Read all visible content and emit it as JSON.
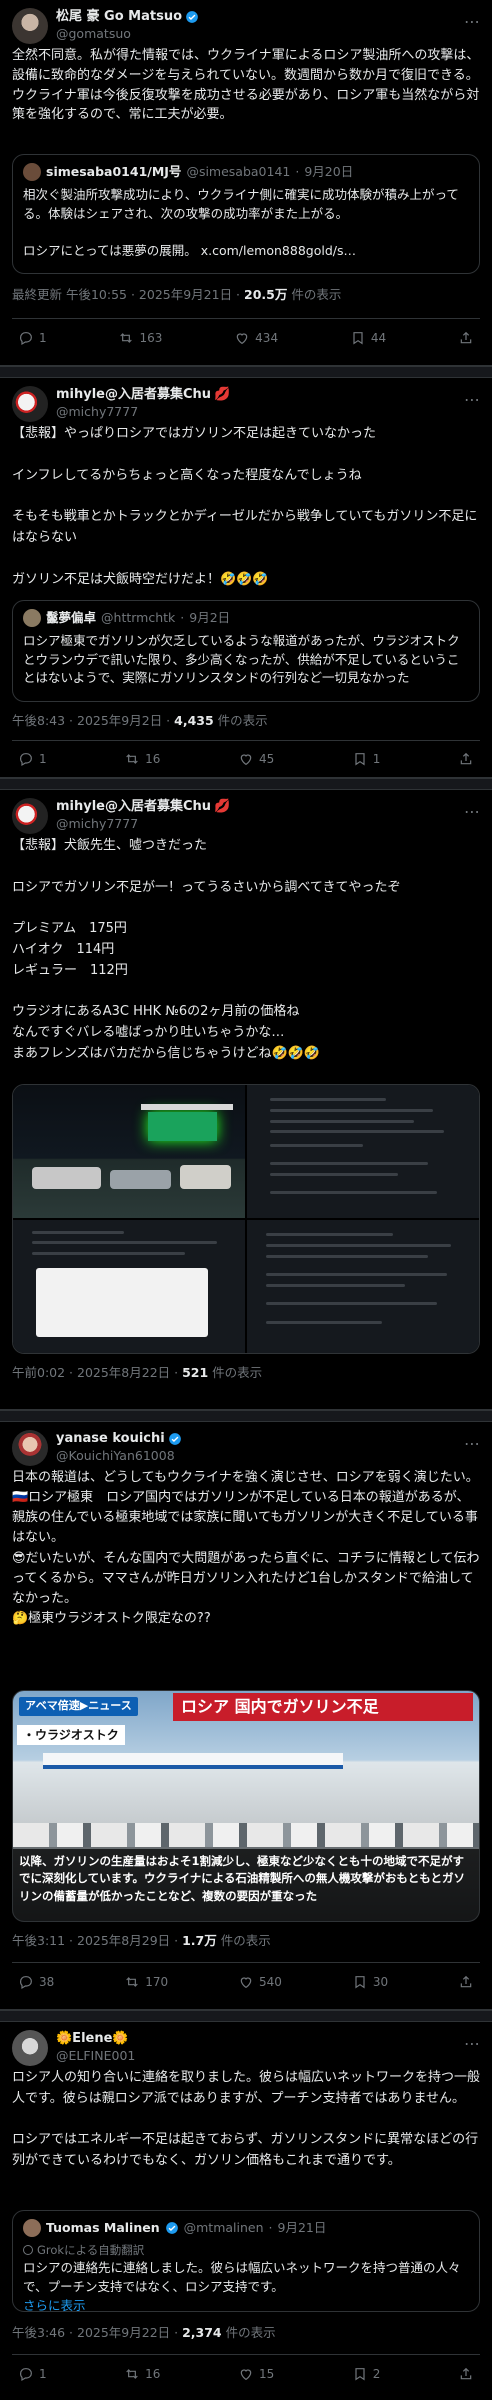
{
  "posts": [
    {
      "name": "松尾 豪 Go Matsuo",
      "handle": "@gomatsuo",
      "text": "全然不同意。私が得た情報では、ウクライナ軍によるロシア製油所への攻撃は、設備に致命的なダメージを与えられていない。数週間から数か月で復旧できる。\nウクライナ軍は今後反復攻撃を成功させる必要があり、ロシア軍も当然ながら対策を強化するので、常に工夫が必要。",
      "quote": {
        "name": "simesaba0141/MJ号",
        "handle": "@simesaba0141",
        "date": "9月20日",
        "text": "相次ぐ製油所攻撃成功により、ウクライナ側に確実に成功体験が積み上がってる。体験はシェアされ、次の攻撃の成功率がまた上がる。\n\nロシアにとっては悪夢の展開。 x.com/lemon888gold/s…"
      },
      "meta_prefix": "最終更新 午後10:55 · 2025年9月21日 · ",
      "views": "20.5万",
      "views_suffix": " 件の表示",
      "replies": "1",
      "reposts": "163",
      "likes": "434",
      "bookmarks": "44"
    },
    {
      "name": "mihyle@入居者募集Chu",
      "handle": "@michy7777",
      "text": "【悲報】やっぱりロシアではガソリン不足は起きていなかった\n\nインフレしてるからちょっと高くなった程度なんでしょうね\n\nそもそも戦車とかトラックとかディーゼルだから戦争していてもガソリン不足にはならない\n\nガソリン不足は犬飯時空だけだよ！🤣🤣🤣",
      "quote": {
        "name": "鬣夢偏卓",
        "handle": "@httrmchtk",
        "date": "9月2日",
        "text": "ロシア極東でガソリンが欠乏しているような報道があったが、ウラジオストクとウランウデで訊いた限り、多少高くなったが、供給が不足しているということはないようで、実際にガソリンスタンドの行列など一切見なかった"
      },
      "meta_prefix": "午後8:43 · 2025年9月2日 · ",
      "views": "4,435",
      "views_suffix": " 件の表示",
      "replies": "1",
      "reposts": "16",
      "likes": "45",
      "bookmarks": "1"
    },
    {
      "name": "mihyle@入居者募集Chu",
      "handle": "@michy7777",
      "text": "【悲報】犬飯先生、嘘つきだった\n\nロシアでガソリン不足が一！ってうるさいから調べてきてやったぞ\n\nプレミアム　175円\nハイオク　114円\nレギュラー　112円\n\nウラジオにあるA3C HHK №6の2ヶ月前の価格ね\nなんですぐバレる嘘ばっかり吐いちゃうかな…\nまあフレンズはバカだから信じちゃうけどね🤣🤣🤣",
      "meta_prefix": "午前0:02 · 2025年8月22日 · ",
      "views": "521",
      "views_suffix": " 件の表示"
    },
    {
      "name": "yanase kouichi",
      "handle": "@KouichiYan61008",
      "text": "日本の報道は、どうしてもウクライナを強く演じさせ、ロシアを弱く演じたい。\n🇷🇺ロシア極東　ロシア国内ではガソリンが不足している日本の報道があるが、親族の住んでいる極東地域では家族に聞いてもガソリンが大きく不足している事はない。\n😎だいたいが、そんな国内で大問題があったら直ぐに、コチラに情報として伝わってくるから。ママさんが昨日ガソリン入れたけど1台しかスタンドで給油してなかった。\n🤔極東ウラジオストク限定なの??",
      "tv_logo": "アベマ倍速▶ニュース",
      "tv_headline": "ロシア 国内でガソリン不足",
      "tv_place": "・ウラジオストク",
      "tv_caption": "以降、ガソリンの生産量はおよそ1割減少し、極東など少なくとも十の地域で不足がすでに深刻化しています。ウクライナによる石油精製所への無人機攻撃がおもともとガソリンの備蓄量が低かったことなど、複数の要因が重なった",
      "meta_prefix": "午後3:11 · 2025年8月29日 · ",
      "views": "1.7万",
      "views_suffix": " 件の表示",
      "replies": "38",
      "reposts": "170",
      "likes": "540",
      "bookmarks": "30"
    },
    {
      "name": "🌼Elene🌼",
      "handle": "@ELFINE001",
      "text": "ロシア人の知り合いに連絡を取りました。彼らは幅広いネットワークを持つ一般人です。彼らは親ロシア派ではありますが、プーチン支持者ではありません。\n\nロシアではエネルギー不足は起きておらず、ガソリンスタンドに異常なほどの行列ができているわけでもなく、ガソリン価格もこれまで通りです。",
      "quote": {
        "name": "Tuomas Malinen",
        "handle": "@mtmalinen",
        "date": "9月21日",
        "grok": "Grokによる自動翻訳",
        "text": "ロシアの連絡先に連絡しました。彼らは幅広いネットワークを持つ普通の人々で、プーチン支持ではなく、ロシア支持です。",
        "more": "さらに表示"
      },
      "meta_prefix": "午後3:46 · 2025年9月22日 · ",
      "views": "2,374",
      "views_suffix": " 件の表示",
      "replies": "1",
      "reposts": "16",
      "likes": "15",
      "bookmarks": "2"
    }
  ],
  "colors": {
    "accent": "#1d9bf0",
    "bg": "#000000",
    "muted": "#71767b",
    "border": "#2f3336",
    "verified": "#1d9bf0"
  },
  "icons": [
    "reply-icon",
    "repost-icon",
    "like-icon",
    "bookmark-icon",
    "verified-icon",
    "more-icon"
  ]
}
